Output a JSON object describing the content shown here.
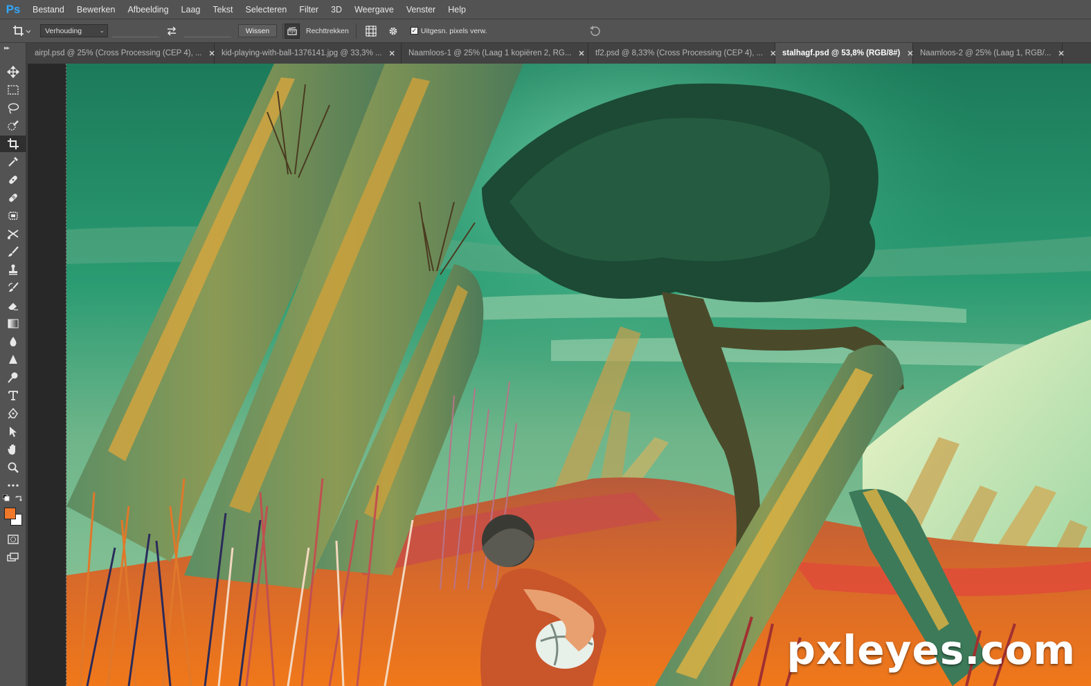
{
  "app": {
    "logo": "Ps",
    "menu": [
      "Bestand",
      "Bewerken",
      "Afbeelding",
      "Laag",
      "Tekst",
      "Selecteren",
      "Filter",
      "3D",
      "Weergave",
      "Venster",
      "Help"
    ]
  },
  "options": {
    "crop_icon": "crop-icon",
    "ratio_select": "Verhouding",
    "swap_icon": "swap-arrows-icon",
    "clear_button": "Wissen",
    "straighten_icon": "straighten-icon",
    "straighten_label": "Rechttrekken",
    "grid_icon": "grid-overlay-icon",
    "settings_icon": "gear-icon",
    "delete_cropped_checked": true,
    "delete_cropped_label": "Uitgesn. pixels verw.",
    "reset_icon": "reset-icon"
  },
  "tabs": [
    {
      "label": "airpl.psd @ 25% (Cross Processing (CEP 4), ...",
      "active": false
    },
    {
      "label": "kid-playing-with-ball-1376141.jpg @ 33,3% ...",
      "active": false
    },
    {
      "label": "Naamloos-1 @ 25% (Laag 1 kopiëren 2, RG...",
      "active": false
    },
    {
      "label": "tf2.psd @ 8,33% (Cross Processing (CEP 4), ...",
      "active": false
    },
    {
      "label": "stalhagf.psd @ 53,8% (RGB/8#)",
      "active": true
    },
    {
      "label": "Naamloos-2 @ 25% (Laag 1, RGB/...",
      "active": false
    }
  ],
  "tools": [
    "move-icon",
    "marquee-icon",
    "lasso-icon",
    "quick-select-icon",
    "crop-icon",
    "eyedropper-icon",
    "spot-heal-icon",
    "bandage-icon",
    "patch-icon",
    "content-move-icon",
    "brush-icon",
    "stamp-icon",
    "history-brush-icon",
    "eraser-icon",
    "gradient-icon",
    "blur-icon",
    "sharpen-icon",
    "dodge-icon",
    "type-icon",
    "pen-icon",
    "path-select-icon",
    "hand-icon",
    "zoom-icon",
    "more-tools-icon"
  ],
  "colors": {
    "foreground": "#f0782a",
    "background": "#ffffff",
    "accent": "#31a8ff"
  },
  "watermark": "pxleyes.com"
}
